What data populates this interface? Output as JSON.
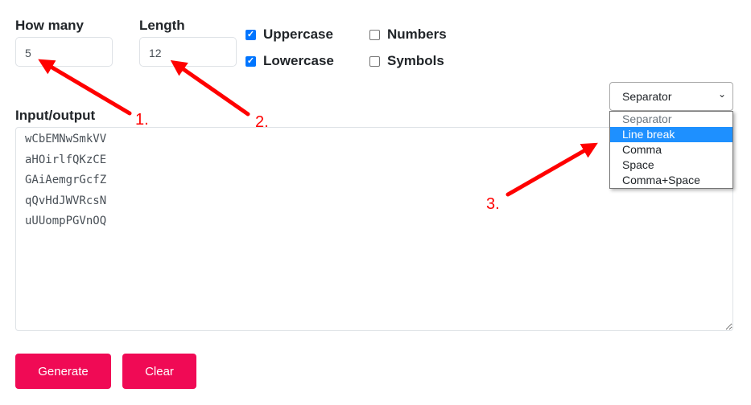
{
  "how_many": {
    "label": "How many",
    "value": "5"
  },
  "length": {
    "label": "Length",
    "value": "12"
  },
  "options": {
    "uppercase": "Uppercase",
    "lowercase": "Lowercase",
    "numbers": "Numbers",
    "symbols": "Symbols",
    "uppercase_checked": true,
    "lowercase_checked": true,
    "numbers_checked": false,
    "symbols_checked": false
  },
  "separator": {
    "selected": "Separator",
    "options": [
      "Separator",
      "Line break",
      "Comma",
      "Space",
      "Comma+Space"
    ],
    "highlighted": "Line break"
  },
  "io": {
    "label": "Input/output",
    "value": "wCbEMNwSmkVV\naHOirlfQKzCE\nGAiAemgrGcfZ\nqQvHdJWVRcsN\nuUUompPGVnOQ"
  },
  "buttons": {
    "generate": "Generate",
    "clear": "Clear"
  },
  "annotations": [
    "1.",
    "2.",
    "3."
  ],
  "colors": {
    "accent": "#f00a55",
    "checkbox": "#0075ff",
    "highlight": "#1e90ff",
    "annotation": "#ff0000"
  }
}
